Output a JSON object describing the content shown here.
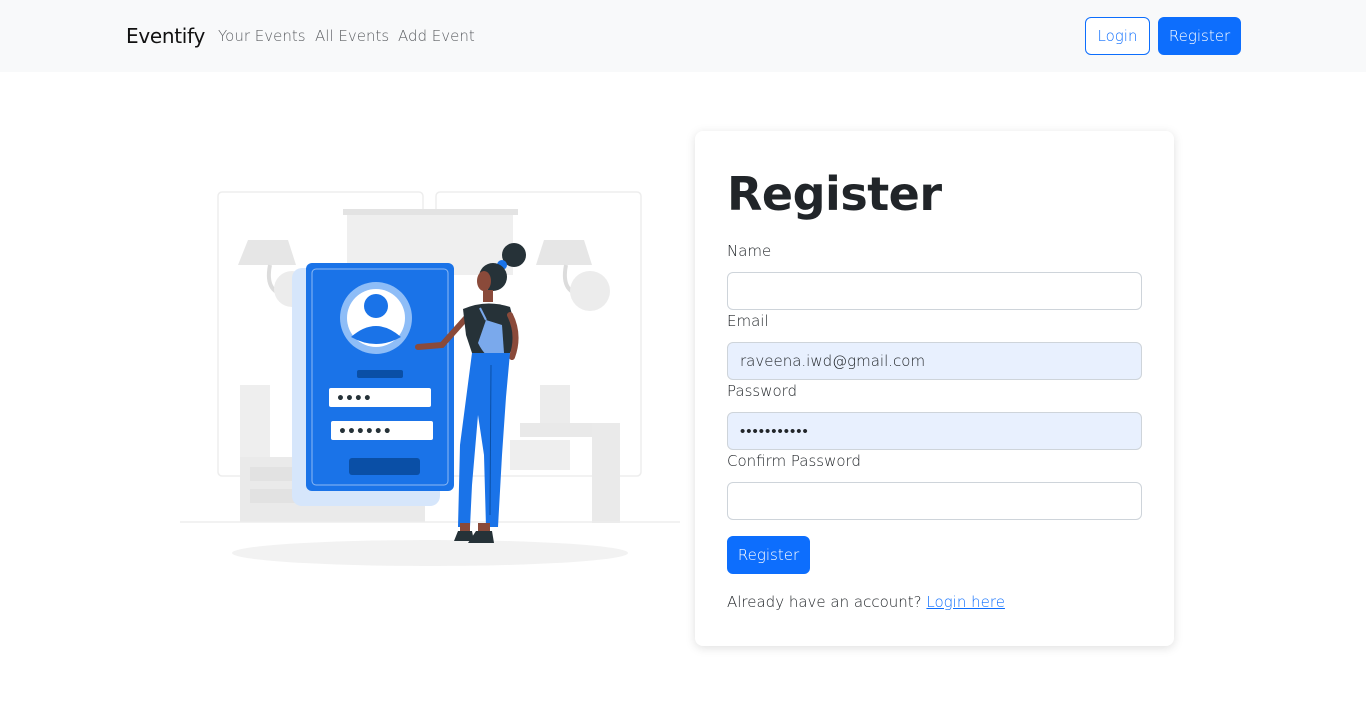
{
  "nav": {
    "brand": "Eventify",
    "links": [
      "Your Events",
      "All Events",
      "Add Event"
    ],
    "login_label": "Login",
    "register_label": "Register"
  },
  "illustration": {
    "icon": "user-registration-illustration",
    "password_dots_1": "••••",
    "password_dots_2": "••••••"
  },
  "form": {
    "title": "Register",
    "name_label": "Name",
    "name_value": "",
    "email_label": "Email",
    "email_value": "raveena.iwd@gmail.com",
    "password_label": "Password",
    "password_value": "•••••••••••",
    "confirm_label": "Confirm Password",
    "confirm_value": "",
    "submit_label": "Register",
    "footer_text": "Already have an account?",
    "footer_link": "Login here"
  },
  "colors": {
    "primary": "#0d6efd",
    "navbar_bg": "#f8f9fa",
    "autofill_bg": "#e8f0fe",
    "illustration_blue": "#1a73e8"
  }
}
